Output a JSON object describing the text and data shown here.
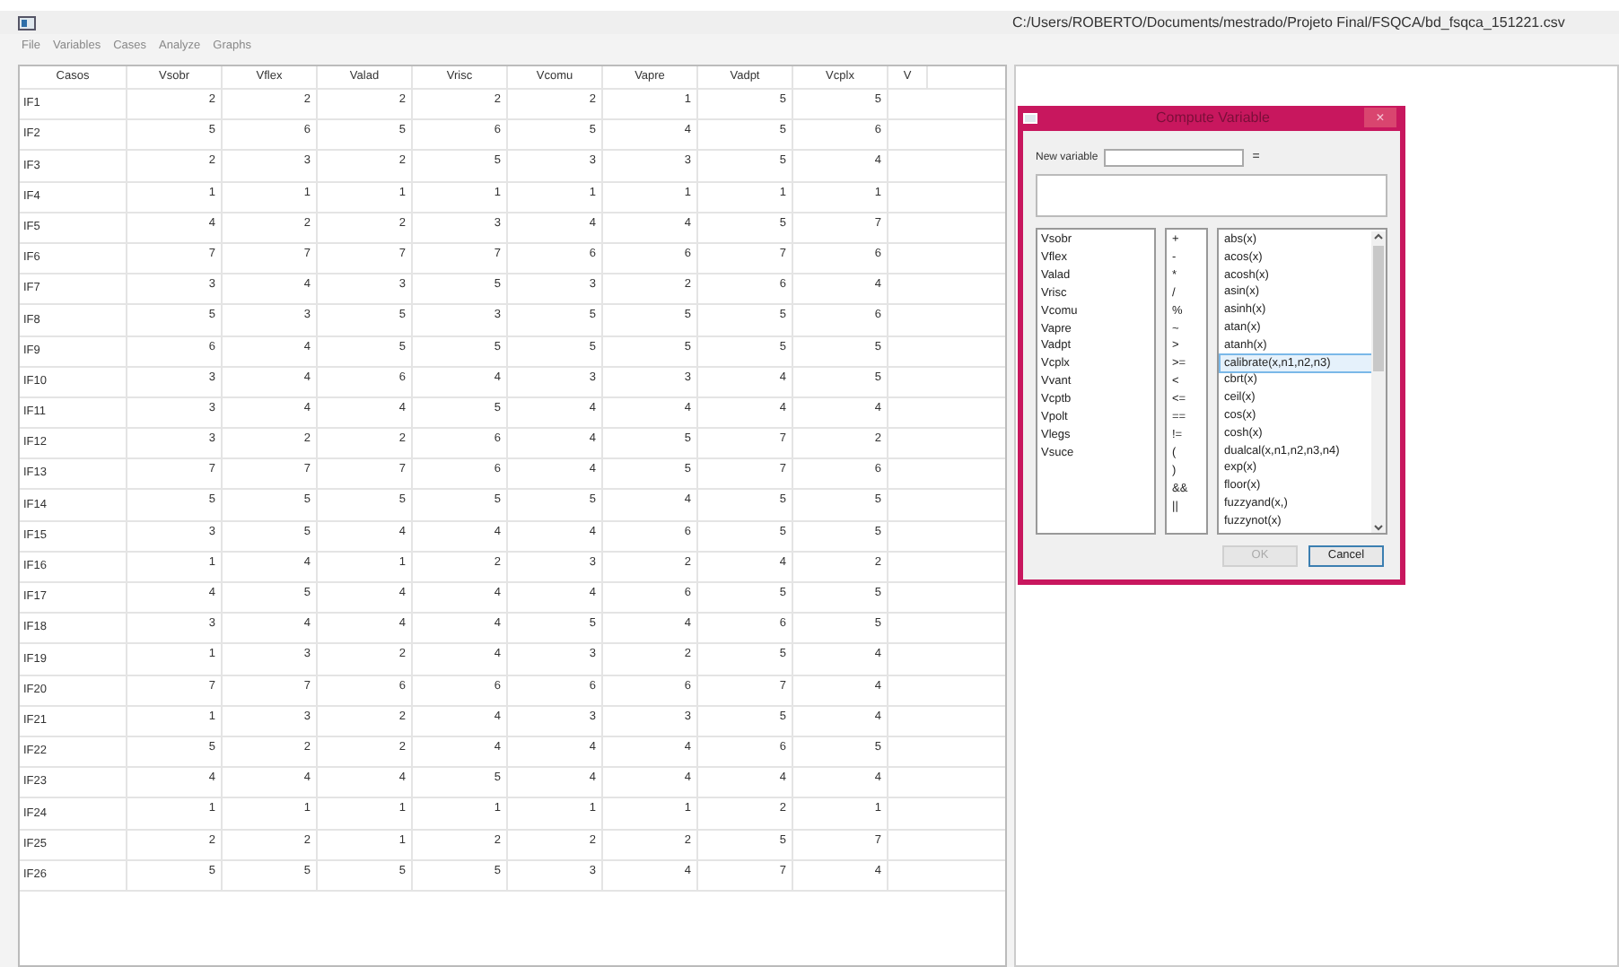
{
  "window": {
    "title": "C:/Users/ROBERTO/Documents/mestrado/Projeto Final/FSQCA/bd_fsqca_151221.csv"
  },
  "menu": [
    "File",
    "Variables",
    "Cases",
    "Analyze",
    "Graphs"
  ],
  "table": {
    "columns": [
      "Casos",
      "Vsobr",
      "Vflex",
      "Valad",
      "Vrisc",
      "Vcomu",
      "Vapre",
      "Vadpt",
      "Vcplx",
      "V"
    ],
    "rows": [
      [
        "IF1",
        "2",
        "2",
        "2",
        "2",
        "2",
        "1",
        "5",
        "5"
      ],
      [
        "IF2",
        "5",
        "6",
        "5",
        "6",
        "5",
        "4",
        "5",
        "6"
      ],
      [
        "IF3",
        "2",
        "3",
        "2",
        "5",
        "3",
        "3",
        "5",
        "4"
      ],
      [
        "IF4",
        "1",
        "1",
        "1",
        "1",
        "1",
        "1",
        "1",
        "1"
      ],
      [
        "IF5",
        "4",
        "2",
        "2",
        "3",
        "4",
        "4",
        "5",
        "7"
      ],
      [
        "IF6",
        "7",
        "7",
        "7",
        "7",
        "6",
        "6",
        "7",
        "6"
      ],
      [
        "IF7",
        "3",
        "4",
        "3",
        "5",
        "3",
        "2",
        "6",
        "4"
      ],
      [
        "IF8",
        "5",
        "3",
        "5",
        "3",
        "5",
        "5",
        "5",
        "6"
      ],
      [
        "IF9",
        "6",
        "4",
        "5",
        "5",
        "5",
        "5",
        "5",
        "5"
      ],
      [
        "IF10",
        "3",
        "4",
        "6",
        "4",
        "3",
        "3",
        "4",
        "5"
      ],
      [
        "IF11",
        "3",
        "4",
        "4",
        "5",
        "4",
        "4",
        "4",
        "4"
      ],
      [
        "IF12",
        "3",
        "2",
        "2",
        "6",
        "4",
        "5",
        "7",
        "2"
      ],
      [
        "IF13",
        "7",
        "7",
        "7",
        "6",
        "4",
        "5",
        "7",
        "6"
      ],
      [
        "IF14",
        "5",
        "5",
        "5",
        "5",
        "5",
        "4",
        "5",
        "5"
      ],
      [
        "IF15",
        "3",
        "5",
        "4",
        "4",
        "4",
        "6",
        "5",
        "5"
      ],
      [
        "IF16",
        "1",
        "4",
        "1",
        "2",
        "3",
        "2",
        "4",
        "2"
      ],
      [
        "IF17",
        "4",
        "5",
        "4",
        "4",
        "4",
        "6",
        "5",
        "5"
      ],
      [
        "IF18",
        "3",
        "4",
        "4",
        "4",
        "5",
        "4",
        "6",
        "5"
      ],
      [
        "IF19",
        "1",
        "3",
        "2",
        "4",
        "3",
        "2",
        "5",
        "4"
      ],
      [
        "IF20",
        "7",
        "7",
        "6",
        "6",
        "6",
        "6",
        "7",
        "4"
      ],
      [
        "IF21",
        "1",
        "3",
        "2",
        "4",
        "3",
        "3",
        "5",
        "4"
      ],
      [
        "IF22",
        "5",
        "2",
        "2",
        "4",
        "4",
        "4",
        "6",
        "5"
      ],
      [
        "IF23",
        "4",
        "4",
        "4",
        "5",
        "4",
        "4",
        "4",
        "4"
      ],
      [
        "IF24",
        "1",
        "1",
        "1",
        "1",
        "1",
        "1",
        "2",
        "1"
      ],
      [
        "IF25",
        "2",
        "2",
        "1",
        "2",
        "2",
        "2",
        "5",
        "7"
      ],
      [
        "IF26",
        "5",
        "5",
        "5",
        "5",
        "3",
        "4",
        "7",
        "4"
      ]
    ]
  },
  "dialog": {
    "title": "Compute Variable",
    "close": "×",
    "new_variable_label": "New variable",
    "equals": "=",
    "variables": [
      "Vsobr",
      "Vflex",
      "Valad",
      "Vrisc",
      "Vcomu",
      "Vapre",
      "Vadpt",
      "Vcplx",
      "Vvant",
      "Vcptb",
      "Vpolt",
      "Vlegs",
      "Vsuce"
    ],
    "operators": [
      "+",
      "-",
      "*",
      "/",
      "%",
      "~",
      ">",
      ">=",
      "<",
      "<=",
      "==",
      "!=",
      "(",
      ")",
      "&&",
      "||"
    ],
    "functions": [
      {
        "label": "abs(x)",
        "selected": false
      },
      {
        "label": "acos(x)",
        "selected": false
      },
      {
        "label": "acosh(x)",
        "selected": false
      },
      {
        "label": "asin(x)",
        "selected": false
      },
      {
        "label": "asinh(x)",
        "selected": false
      },
      {
        "label": "atan(x)",
        "selected": false
      },
      {
        "label": "atanh(x)",
        "selected": false
      },
      {
        "label": "calibrate(x,n1,n2,n3)",
        "selected": true
      },
      {
        "label": "cbrt(x)",
        "selected": false
      },
      {
        "label": "ceil(x)",
        "selected": false
      },
      {
        "label": "cos(x)",
        "selected": false
      },
      {
        "label": "cosh(x)",
        "selected": false
      },
      {
        "label": "dualcal(x,n1,n2,n3,n4)",
        "selected": false
      },
      {
        "label": "exp(x)",
        "selected": false
      },
      {
        "label": "floor(x)",
        "selected": false
      },
      {
        "label": "fuzzyand(x,)",
        "selected": false
      },
      {
        "label": "fuzzynot(x)",
        "selected": false
      }
    ],
    "buttons": [
      {
        "label": "OK",
        "disabled": true
      },
      {
        "label": "Cancel",
        "disabled": false
      }
    ]
  }
}
